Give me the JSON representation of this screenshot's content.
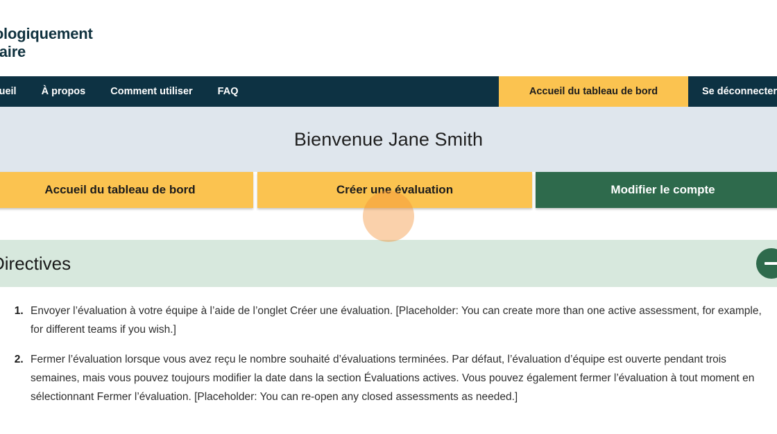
{
  "brand": {
    "logo_text": "Psychologiquement\nsécuritaire"
  },
  "nav": {
    "items": [
      {
        "label": "Accueil",
        "style": "plain"
      },
      {
        "label": "À propos",
        "style": "plain"
      },
      {
        "label": "Comment utiliser",
        "style": "plain"
      },
      {
        "label": "FAQ",
        "style": "plain"
      }
    ],
    "highlight": {
      "label": "Accueil du tableau de bord"
    },
    "logout": {
      "label": "Se déconnecter"
    },
    "colors": {
      "bar_background": "#0d3243",
      "highlight_background": "#fbc350",
      "text": "#ffffff"
    }
  },
  "welcome": {
    "title": "Bienvenue Jane Smith",
    "background": "#dfe6ed"
  },
  "actions": {
    "dashboard_home": {
      "label": "Accueil du tableau de bord",
      "color": "#fbc350"
    },
    "create_assessment": {
      "label": "Créer une évaluation",
      "color": "#fbc350"
    },
    "edit_account": {
      "label": "Modifier le compte",
      "color": "#2e6a4c"
    }
  },
  "directives": {
    "heading": "Directives",
    "band_color": "#d7e8dd",
    "collapse_icon": "minus-circle-icon",
    "steps": [
      "Envoyer l’évaluation à votre équipe à l’aide de l’onglet Créer une évaluation. [Placeholder: You can create more than one active assessment, for example, for different teams if you wish.]",
      "Fermer l’évaluation lorsque vous avez reçu le nombre souhaité d’évaluations terminées. Par défaut, l’évaluation d’équipe est ouverte pendant trois semaines, mais vous pouvez toujours modifier la date dans la section Évaluations actives. Vous pouvez également fermer l’évaluation à tout moment en sélectionnant Fermer l’évaluation. [Placeholder: You can re-open any closed assessments as needed.]"
    ]
  },
  "cursor": {
    "highlight_color": "#f39237"
  }
}
